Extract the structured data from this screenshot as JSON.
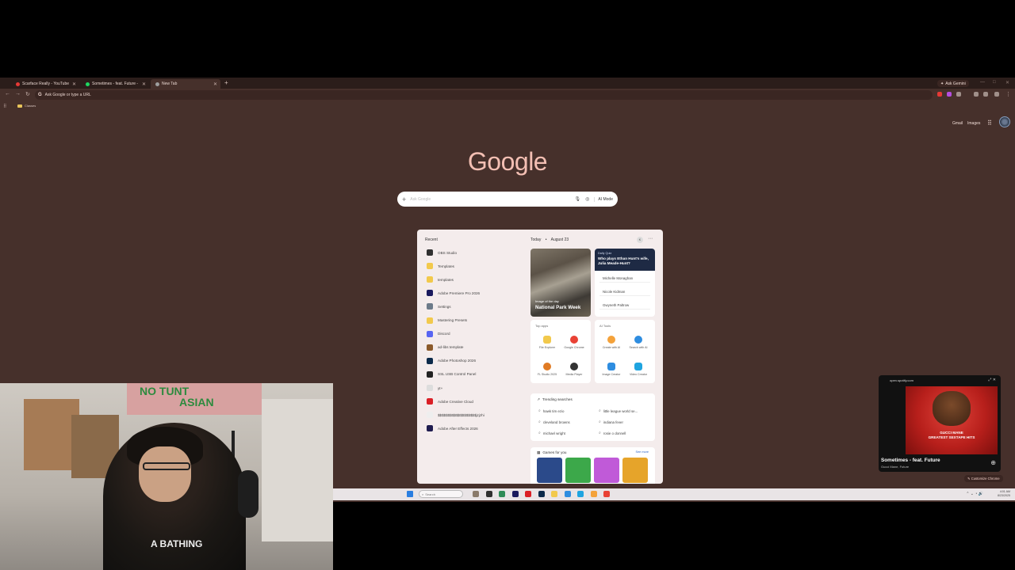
{
  "browser": {
    "tabs": [
      {
        "title": "Scarface Really - YouTube",
        "color": "#e53935"
      },
      {
        "title": "Sometimes - feat. Future - ",
        "color": "#1ed760"
      },
      {
        "title": "New Tab",
        "color": "#9e9e9e"
      }
    ],
    "new_tab_symbol": "+",
    "gemini_label": "Ask Gemini",
    "omnibox_placeholder": "Ask Google or type a URL",
    "bookmark_folder": "Classes",
    "nav_icons": [
      "back-icon",
      "forward-icon",
      "reload-icon"
    ]
  },
  "ntp": {
    "gmail": "Gmail",
    "images": "Images",
    "logo": "Google",
    "search_placeholder": "Ask Google",
    "ai_mode": "AI Mode",
    "customize": "Customize Chrome"
  },
  "start_menu": {
    "recent_title": "Recent",
    "recent": [
      {
        "label": "OBS Studio",
        "color": "#303030"
      },
      {
        "label": "Templates",
        "color": "#f2c94c"
      },
      {
        "label": "templates",
        "color": "#f2c94c"
      },
      {
        "label": "Adobe Premiere Pro 2026",
        "color": "#1a1a5e"
      },
      {
        "label": "Settings",
        "color": "#6c7a89"
      },
      {
        "label": "Mastering Presets",
        "color": "#f2c94c"
      },
      {
        "label": "Discord",
        "color": "#5865f2"
      },
      {
        "label": "ad-libs template",
        "color": "#8b5a2b"
      },
      {
        "label": "Adobe Photoshop 2026",
        "color": "#0b2a4a"
      },
      {
        "label": "SSL USB Control Panel",
        "color": "#222222"
      },
      {
        "label": "yt+",
        "color": "#dddddd"
      },
      {
        "label": "Adobe Creative Cloud",
        "color": "#da1f26"
      },
      {
        "label": "$$$$$$$$$$$$$$$$$$$jzjzhi",
        "color": "#eeeeee"
      },
      {
        "label": "Adobe After Effects 2026",
        "color": "#1f1c4f"
      }
    ],
    "today": "Today",
    "date": "August 23",
    "iotd_label": "Image of the day",
    "iotd_title": "National Park Week",
    "quiz_tag": "Daily Quiz",
    "quiz_question": "Who plays Ethan Hunt's wife, Julia Meade-Hunt?",
    "quiz_options": [
      "Michelle Monaghan",
      "Nicole Kidman",
      "Gwyneth Paltrow"
    ],
    "top_apps_title": "Top apps",
    "top_apps": [
      {
        "label": "File Explorer",
        "color": "#f2c94c"
      },
      {
        "label": "Google Chrome",
        "color": "#e94235"
      },
      {
        "label": "FL Studio 2025",
        "color": "#e07b24"
      },
      {
        "label": "Media Player",
        "color": "#333333"
      }
    ],
    "ai_tools_title": "AI Tools",
    "ai_tools": [
      {
        "label": "Create with AI",
        "color": "#f4a23a"
      },
      {
        "label": "Search with AI",
        "color": "#2e8de0"
      },
      {
        "label": "Image Creator",
        "color": "#2e8de0"
      },
      {
        "label": "Video Creator",
        "color": "#1fa4e0"
      }
    ],
    "trending_title": "Trending searches",
    "trending": [
      "hawk tim ezio",
      "little league world se...",
      "cleveland browns",
      "indiana fever",
      "michael wright",
      "rosie o donnell"
    ],
    "games_title": "Games for you",
    "games_more": "See more",
    "games": [
      {
        "color": "#2b4a8a"
      },
      {
        "color": "#3ca84a"
      },
      {
        "color": "#c05ad8"
      },
      {
        "color": "#e6a42a"
      }
    ]
  },
  "taskbar": {
    "search_placeholder": "Search",
    "time": "4:01 AM",
    "date": "8/23/2025",
    "apps": [
      {
        "color": "#8a7a6a"
      },
      {
        "color": "#303030"
      },
      {
        "color": "#2e8b57"
      },
      {
        "color": "#1a1a5e"
      },
      {
        "color": "#da1f26"
      },
      {
        "color": "#0b2a4a"
      },
      {
        "color": "#f2c94c"
      },
      {
        "color": "#2e8de0"
      },
      {
        "color": "#1fa4e0"
      },
      {
        "color": "#f4a23a"
      },
      {
        "color": "#e94235"
      }
    ]
  },
  "mini_player": {
    "host": "open.spotify.com",
    "art_line1": "GUCCI MANE",
    "art_line2": "GREATEST SEXTAPE HITS",
    "title": "Sometimes - feat. Future",
    "artist": "Gucci Mane, Future"
  },
  "webcam": {
    "banner_line1": "NO TUNT",
    "banner_line2": "ASIAN",
    "shirt_text": "A BATHING"
  }
}
